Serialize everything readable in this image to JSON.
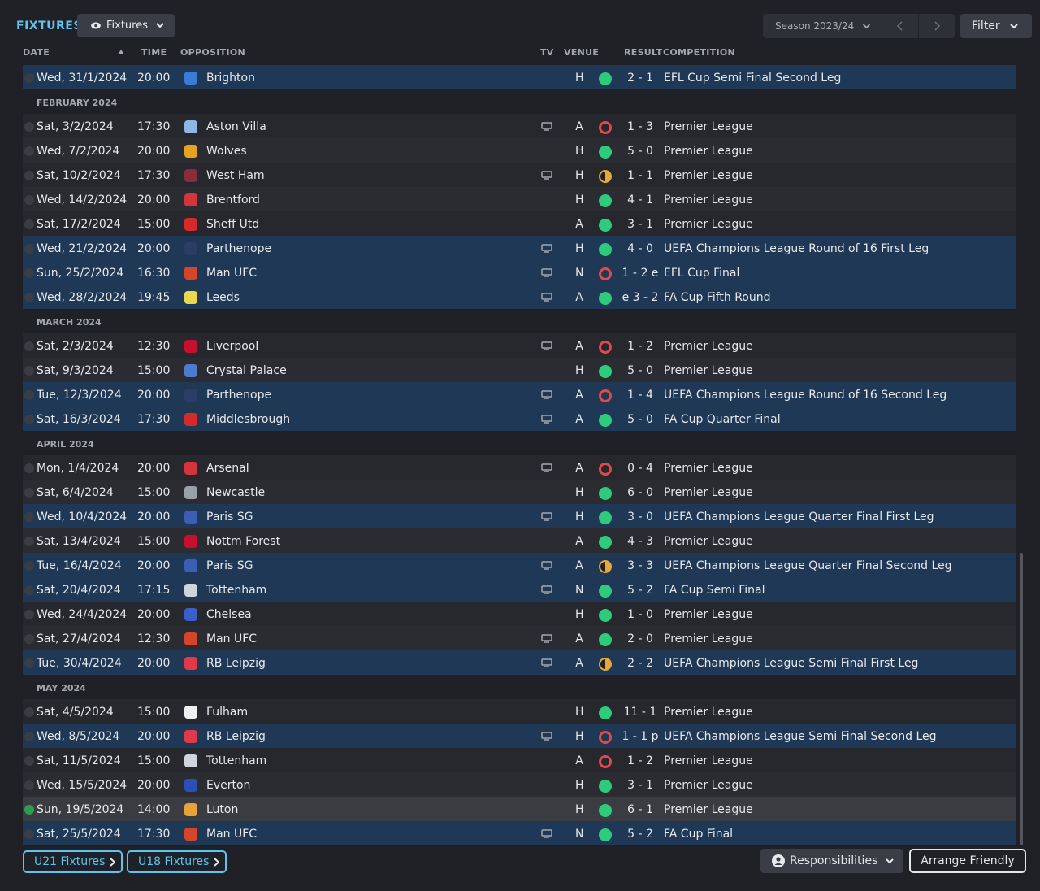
{
  "header": {
    "title": "FIXTURES",
    "view_dropdown": "Fixtures",
    "season": "Season 2023/24",
    "filter": "Filter"
  },
  "columns": {
    "date": "DATE",
    "time": "TIME",
    "opposition": "OPPOSITION",
    "tv": "TV",
    "venue": "VENUE",
    "result": "RESULT",
    "competition": "COMPETITION"
  },
  "colors": {
    "accent": "#5ec3f0",
    "win": "#2ecb7d",
    "loss": "#e04a4a",
    "draw": "#e7a83a",
    "cup_row": "#1f3855"
  },
  "items": [
    {
      "type": "match",
      "date": "Wed, 31/1/2024",
      "time": "20:00",
      "opp": "Brighton",
      "badge": "#3a7bd5",
      "tv": false,
      "venue": "H",
      "res": "W",
      "score": "2 - 1",
      "comp": "EFL Cup Semi Final Second Leg",
      "cup": true
    },
    {
      "type": "month",
      "label": "FEBRUARY 2024"
    },
    {
      "type": "match",
      "date": "Sat, 3/2/2024",
      "time": "17:30",
      "opp": "Aston Villa",
      "badge": "#8fb7e3",
      "tv": true,
      "venue": "A",
      "res": "L",
      "score": "1 - 3",
      "comp": "Premier League"
    },
    {
      "type": "match",
      "date": "Wed, 7/2/2024",
      "time": "20:00",
      "opp": "Wolves",
      "badge": "#e6a321",
      "tv": false,
      "venue": "H",
      "res": "W",
      "score": "5 - 0",
      "comp": "Premier League"
    },
    {
      "type": "match",
      "date": "Sat, 10/2/2024",
      "time": "17:30",
      "opp": "West Ham",
      "badge": "#8a2d3a",
      "tv": true,
      "venue": "H",
      "res": "D",
      "score": "1 - 1",
      "comp": "Premier League"
    },
    {
      "type": "match",
      "date": "Wed, 14/2/2024",
      "time": "20:00",
      "opp": "Brentford",
      "badge": "#d6333a",
      "tv": false,
      "venue": "H",
      "res": "W",
      "score": "4 - 1",
      "comp": "Premier League"
    },
    {
      "type": "match",
      "date": "Sat, 17/2/2024",
      "time": "15:00",
      "opp": "Sheff Utd",
      "badge": "#d62a2a",
      "tv": false,
      "venue": "A",
      "res": "W",
      "score": "3 - 1",
      "comp": "Premier League"
    },
    {
      "type": "match",
      "date": "Wed, 21/2/2024",
      "time": "20:00",
      "opp": "Parthenope",
      "badge": "#2a3d66",
      "tv": true,
      "venue": "H",
      "res": "W",
      "score": "4 - 0",
      "comp": "UEFA Champions League Round of 16  First Leg",
      "cup": true
    },
    {
      "type": "match",
      "date": "Sun, 25/2/2024",
      "time": "16:30",
      "opp": "Man UFC",
      "badge": "#d6452a",
      "tv": true,
      "venue": "N",
      "res": "L",
      "score": "1 - 2 e",
      "comp": "EFL Cup Final",
      "cup": true
    },
    {
      "type": "match",
      "date": "Wed, 28/2/2024",
      "time": "19:45",
      "opp": "Leeds",
      "badge": "#e8d84a",
      "tv": true,
      "venue": "A",
      "res": "W",
      "score": "e 3 - 2",
      "comp": "FA Cup Fifth Round",
      "cup": true
    },
    {
      "type": "month",
      "label": "MARCH 2024"
    },
    {
      "type": "match",
      "date": "Sat, 2/3/2024",
      "time": "12:30",
      "opp": "Liverpool",
      "badge": "#c8102e",
      "tv": true,
      "venue": "A",
      "res": "L",
      "score": "1 - 2",
      "comp": "Premier League"
    },
    {
      "type": "match",
      "date": "Sat, 9/3/2024",
      "time": "15:00",
      "opp": "Crystal Palace",
      "badge": "#4c7bd0",
      "tv": false,
      "venue": "H",
      "res": "W",
      "score": "5 - 0",
      "comp": "Premier League"
    },
    {
      "type": "match",
      "date": "Tue, 12/3/2024",
      "time": "20:00",
      "opp": "Parthenope",
      "badge": "#2a3d66",
      "tv": true,
      "venue": "A",
      "res": "L",
      "score": "1 - 4",
      "comp": "UEFA Champions League Round of 16  Second Leg",
      "cup": true
    },
    {
      "type": "match",
      "date": "Sat, 16/3/2024",
      "time": "17:30",
      "opp": "Middlesbrough",
      "badge": "#d62a2a",
      "tv": true,
      "venue": "A",
      "res": "W",
      "score": "5 - 0",
      "comp": "FA Cup Quarter Final",
      "cup": true
    },
    {
      "type": "month",
      "label": "APRIL 2024"
    },
    {
      "type": "match",
      "date": "Mon, 1/4/2024",
      "time": "20:00",
      "opp": "Arsenal",
      "badge": "#d6333a",
      "tv": true,
      "venue": "A",
      "res": "L",
      "score": "0 - 4",
      "comp": "Premier League"
    },
    {
      "type": "match",
      "date": "Sat, 6/4/2024",
      "time": "15:00",
      "opp": "Newcastle",
      "badge": "#9aa0a8",
      "tv": false,
      "venue": "H",
      "res": "W",
      "score": "6 - 0",
      "comp": "Premier League"
    },
    {
      "type": "match",
      "date": "Wed, 10/4/2024",
      "time": "20:00",
      "opp": "Paris SG",
      "badge": "#3a5fb5",
      "tv": true,
      "venue": "H",
      "res": "W",
      "score": "3 - 0",
      "comp": "UEFA Champions League Quarter Final First Leg",
      "cup": true
    },
    {
      "type": "match",
      "date": "Sat, 13/4/2024",
      "time": "15:00",
      "opp": "Nottm Forest",
      "badge": "#c8102e",
      "tv": false,
      "venue": "A",
      "res": "W",
      "score": "4 - 3",
      "comp": "Premier League"
    },
    {
      "type": "match",
      "date": "Tue, 16/4/2024",
      "time": "20:00",
      "opp": "Paris SG",
      "badge": "#3a5fb5",
      "tv": true,
      "venue": "A",
      "res": "D",
      "score": "3 - 3",
      "comp": "UEFA Champions League Quarter Final Second Leg",
      "cup": true
    },
    {
      "type": "match",
      "date": "Sat, 20/4/2024",
      "time": "17:15",
      "opp": "Tottenham",
      "badge": "#d0d4dc",
      "tv": true,
      "venue": "N",
      "res": "W",
      "score": "5 - 2",
      "comp": "FA Cup Semi Final",
      "cup": true
    },
    {
      "type": "match",
      "date": "Wed, 24/4/2024",
      "time": "20:00",
      "opp": "Chelsea",
      "badge": "#3a5fc8",
      "tv": false,
      "venue": "H",
      "res": "W",
      "score": "1 - 0",
      "comp": "Premier League"
    },
    {
      "type": "match",
      "date": "Sat, 27/4/2024",
      "time": "12:30",
      "opp": "Man UFC",
      "badge": "#d6452a",
      "tv": true,
      "venue": "A",
      "res": "W",
      "score": "2 - 0",
      "comp": "Premier League"
    },
    {
      "type": "match",
      "date": "Tue, 30/4/2024",
      "time": "20:00",
      "opp": "RB Leipzig",
      "badge": "#e03a4a",
      "tv": true,
      "venue": "A",
      "res": "D",
      "score": "2 - 2",
      "comp": "UEFA Champions League Semi Final First Leg",
      "cup": true
    },
    {
      "type": "month",
      "label": "MAY 2024"
    },
    {
      "type": "match",
      "date": "Sat, 4/5/2024",
      "time": "15:00",
      "opp": "Fulham",
      "badge": "#f0f0f0",
      "tv": false,
      "venue": "H",
      "res": "W",
      "score": "11 - 1",
      "comp": "Premier League"
    },
    {
      "type": "match",
      "date": "Wed, 8/5/2024",
      "time": "20:00",
      "opp": "RB Leipzig",
      "badge": "#e03a4a",
      "tv": true,
      "venue": "H",
      "res": "L",
      "score": "1 - 1 p",
      "comp": "UEFA Champions League Semi Final Second Leg",
      "cup": true
    },
    {
      "type": "match",
      "date": "Sat, 11/5/2024",
      "time": "15:00",
      "opp": "Tottenham",
      "badge": "#d0d4dc",
      "tv": false,
      "venue": "A",
      "res": "L",
      "score": "1 - 2",
      "comp": "Premier League"
    },
    {
      "type": "match",
      "date": "Wed, 15/5/2024",
      "time": "20:00",
      "opp": "Everton",
      "badge": "#2a4fb5",
      "tv": false,
      "venue": "H",
      "res": "W",
      "score": "3 - 1",
      "comp": "Premier League"
    },
    {
      "type": "match",
      "date": "Sun, 19/5/2024",
      "time": "14:00",
      "opp": "Luton",
      "badge": "#e8a23a",
      "tv": false,
      "venue": "H",
      "res": "W",
      "score": "6 - 1",
      "comp": "Premier League",
      "sel": true,
      "done": true
    },
    {
      "type": "match",
      "date": "Sat, 25/5/2024",
      "time": "17:30",
      "opp": "Man UFC",
      "badge": "#d6452a",
      "tv": true,
      "venue": "N",
      "res": "W",
      "score": "5 - 2",
      "comp": "FA Cup Final",
      "cup": true
    }
  ],
  "footer": {
    "u21": "U21 Fixtures",
    "u18": "U18 Fixtures",
    "responsibilities": "Responsibilities",
    "arrange": "Arrange Friendly"
  }
}
